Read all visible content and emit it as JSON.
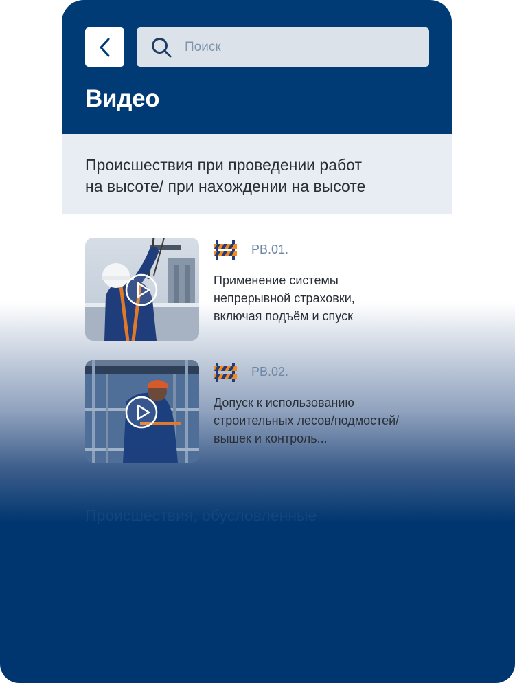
{
  "header": {
    "back_label": "Назад",
    "search_placeholder": "Поиск",
    "title": "Видео"
  },
  "section": {
    "title": "Происшествия при проведении работ\nна высоте/ при нахождении на высоте"
  },
  "videos": [
    {
      "code": "РВ.01.",
      "title": "Применение системы\nнепрерывной страховки,\nвключая подъём и спуск",
      "icon": "road-barrier-icon"
    },
    {
      "code": "РВ.02.",
      "title": "Допуск к использованию\nстроительных лесов/подмостей/\nвышек и контроль...",
      "icon": "road-barrier-icon"
    }
  ],
  "next_section": {
    "title": "Происшествия, обусловленные"
  },
  "colors": {
    "brand_blue": "#003b76",
    "section_bg": "#e8edf3",
    "accent_orange": "#f28a1e"
  }
}
